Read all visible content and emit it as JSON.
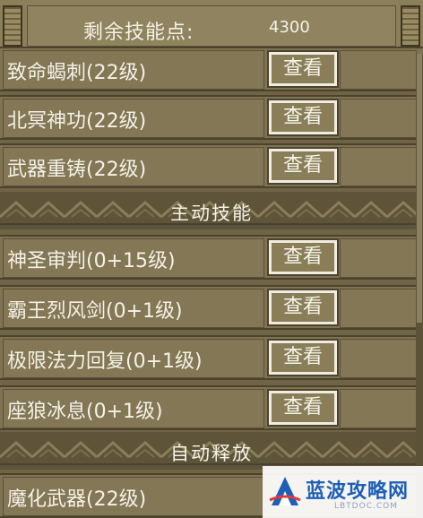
{
  "header": {
    "skill_points_label": "剩余技能点:",
    "skill_points_value": "4300"
  },
  "view_label": "查看",
  "skills_top": [
    {
      "name": "致命蝎刺(22级)"
    },
    {
      "name": "北冥神功(22级)"
    },
    {
      "name": "武器重铸(22级)"
    }
  ],
  "section_active": {
    "title": "主动技能"
  },
  "skills_active": [
    {
      "name": "神圣审判(0+15级)"
    },
    {
      "name": "霸王烈风剑(0+1级)"
    },
    {
      "name": "极限法力回复(0+1级)"
    },
    {
      "name": "座狼冰息(0+1级)"
    }
  ],
  "section_auto": {
    "title": "自动释放"
  },
  "skills_auto": [
    {
      "name": "魔化武器(22级)"
    }
  ],
  "watermark": {
    "text": "蓝波攻略网",
    "sub": "LBTDOC.COM"
  },
  "colors": {
    "panel": "#7f7352",
    "banner": "#5e5439",
    "text": "#f4f1e6",
    "watermark": "#1e5fb8"
  }
}
